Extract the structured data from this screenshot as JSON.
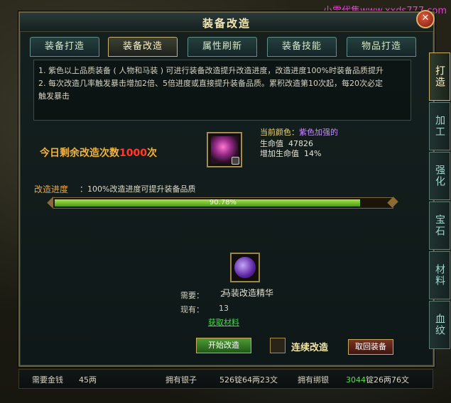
{
  "watermark": "小雪代售www.xxds777.com",
  "window": {
    "title": "装备改造",
    "close_label": "✕"
  },
  "tabs": [
    {
      "label": "装备打造"
    },
    {
      "label": "装备改造",
      "active": true
    },
    {
      "label": "属性刷新"
    },
    {
      "label": "装备技能"
    },
    {
      "label": "物品打造"
    }
  ],
  "side_tabs": [
    {
      "label": "打造",
      "active": true
    },
    {
      "label": "加工"
    },
    {
      "label": "强化"
    },
    {
      "label": "宝石"
    },
    {
      "label": "材料"
    },
    {
      "label": "血纹"
    }
  ],
  "info": {
    "line1": "1. 紫色以上品质装备 ( 人物和马装 ) 可进行装备改造提升改造进度，改造进度100%时装备品质提升",
    "line2": "2. 每次改造几率触发暴击增加2倍、5倍进度或直接提升装备品质。累积改造第10次起，每20次必定",
    "line3": "触发暴击"
  },
  "equipment": {
    "color_label": "当前颜色：",
    "color_value": "紫色加强的",
    "hp_label": "生命值",
    "hp_value": "47826",
    "hp_bonus_label": "增加生命值",
    "hp_bonus_value": "14%"
  },
  "today": {
    "prefix": "今日剩余改造次数",
    "count": "1000",
    "suffix": "次"
  },
  "progress": {
    "label": "改造进度",
    "desc": "：100%改造进度可提升装备品质",
    "value": 90.78,
    "text": "90.78%"
  },
  "material": {
    "name": "马装改造精华",
    "need_label": "需要：",
    "need_value": "2",
    "have_label": "现有：",
    "have_value": "13",
    "get_link": "获取材料"
  },
  "buttons": {
    "start": "开始改造",
    "continuous": "连续改造",
    "retrieve": "取回装备"
  },
  "bottom": {
    "gold_label": "需要金钱",
    "gold_value": "45两",
    "silver_label": "拥有银子",
    "silver_value": "526锭64两23文",
    "bound_label": "拥有绑银",
    "bound_value_green": "3044",
    "bound_value_rest": "锭26两76文"
  },
  "colors": {
    "accent": "#c8b26d",
    "progress": "#7ecb2e",
    "count": "#ff3b2b"
  }
}
